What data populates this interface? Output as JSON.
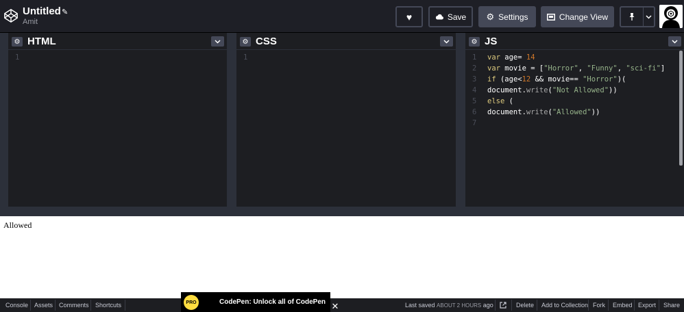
{
  "header": {
    "title": "Untitled",
    "author": "Amit",
    "buttons": {
      "save": "Save",
      "settings": "Settings",
      "change_view": "Change View"
    }
  },
  "editors": {
    "html": {
      "label": "HTML",
      "lines": [
        "1"
      ]
    },
    "css": {
      "label": "CSS",
      "lines": [
        "1"
      ]
    },
    "js": {
      "label": "JS"
    }
  },
  "js_code": [
    {
      "n": "1",
      "text": "var age= 14"
    },
    {
      "n": "2",
      "text": "var movie = [\"Horror\", \"Funny\", \"sci-fi\"]"
    },
    {
      "n": "3",
      "text": "if (age<12 && movie== \"Horror\")("
    },
    {
      "n": "4",
      "text": "document.write(\"Not Allowed\"))"
    },
    {
      "n": "5",
      "text": "else ("
    },
    {
      "n": "6",
      "text": "document.write(\"Allowed\"))"
    },
    {
      "n": "7",
      "text": ""
    }
  ],
  "preview": {
    "output": "Allowed"
  },
  "footer": {
    "console": "Console",
    "assets": "Assets",
    "comments": "Comments",
    "shortcuts": "Shortcuts",
    "last_saved_label": "Last saved",
    "last_saved_time": "ABOUT 2 HOURS",
    "last_saved_suffix": "ago",
    "delete": "Delete",
    "add_to_collection": "Add to Collection",
    "fork": "Fork",
    "embed": "Embed",
    "export": "Export",
    "share": "Share"
  },
  "promo": {
    "badge": "PRO",
    "text": "CodePen: Unlock all of CodePen"
  },
  "colors": {
    "header_bg": "#1e1f26",
    "editor_bg": "#1d1e22",
    "button_bg": "#444857",
    "pro_yellow": "#ffdd40"
  }
}
